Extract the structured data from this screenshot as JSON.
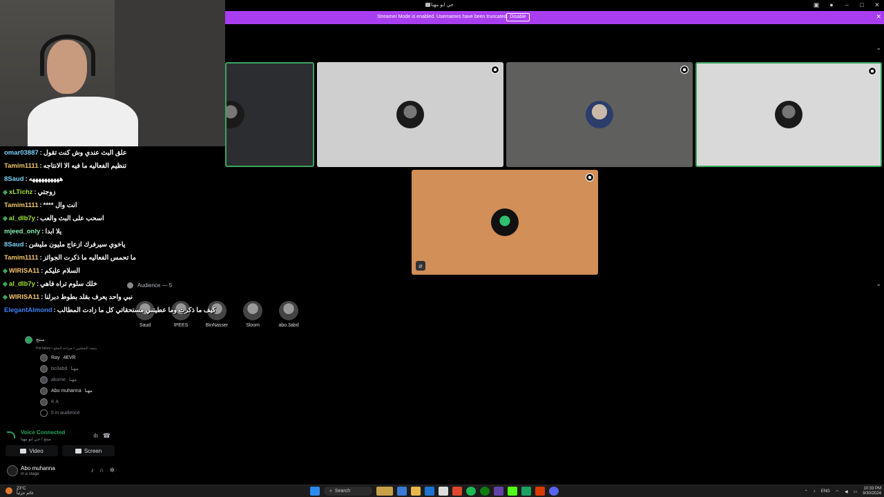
{
  "window": {
    "title": "حي ابو مهنا"
  },
  "banner": {
    "message": "Streamer Mode is enabled. Usernames have been truncated.",
    "disable_label": "Disable"
  },
  "audience": {
    "header": "Audience — 5",
    "members": [
      "Saud",
      "IPEES",
      "BinNasser",
      "Sloom",
      "abo.3abd"
    ]
  },
  "chat": [
    {
      "user": "omar03887",
      "color": "#7dd3fc",
      "badge": false,
      "text": "علق البث عندي وش كنت تقول"
    },
    {
      "user": "Tamim1111",
      "color": "#f5c76b",
      "badge": false,
      "text": "تنظيم الفعاليه ما فيه الا الانتاجه"
    },
    {
      "user": "8Saud",
      "color": "#7dd3fc",
      "badge": false,
      "text": "ههههههههههه"
    },
    {
      "user": "xLTichz",
      "color": "#a3e635",
      "badge": true,
      "text": "زوجتي"
    },
    {
      "user": "Tamim1111",
      "color": "#f5c76b",
      "badge": false,
      "text": "انت وال ****"
    },
    {
      "user": "al_dlb7y",
      "color": "#a3e635",
      "badge": true,
      "text": "اسحب على البث والعب"
    },
    {
      "user": "mjeed_only",
      "color": "#86efac",
      "badge": false,
      "text": "يلا ابدا"
    },
    {
      "user": "8Saud",
      "color": "#7dd3fc",
      "badge": false,
      "text": "ياخوي سيرفرك ازعاج مليون مليشن"
    },
    {
      "user": "Tamim1111",
      "color": "#f5c76b",
      "badge": false,
      "text": "ما تحمس الفعاليه ما ذكرت الجوائز"
    },
    {
      "user": "WIRISA11",
      "color": "#f5c76b",
      "badge": true,
      "text": "السلام عليكم"
    },
    {
      "user": "al_dlb7y",
      "color": "#a3e635",
      "badge": true,
      "text": "خلك سلوم تراه فاهي"
    },
    {
      "user": "WIRISA11",
      "color": "#f5c76b",
      "badge": true,
      "text": "نبي واحد يعرف بقلد بطوط دبرلنا"
    },
    {
      "user": "ElegantAlmond",
      "color": "#3b82f6",
      "badge": false,
      "text": "كيف ما ذكرت وما عطيتني مستحقاتي كل ما زادت المطالب"
    }
  ],
  "sidebar": {
    "stage_row": {
      "label": "منتج",
      "sub": "Hot takes • منصة الشعليين • صراحه الشلع"
    },
    "members": [
      {
        "name": "Ray",
        "tag": "4EVR",
        "dim": false
      },
      {
        "name": "bo3abd",
        "tag": "مهنا",
        "dim": true
      },
      {
        "name": "akome",
        "tag": "مهنا",
        "dim": true
      },
      {
        "name": "Abo muhanna",
        "tag": "مهنا",
        "dim": false
      },
      {
        "name": "K A",
        "tag": "",
        "dim": true
      }
    ],
    "in_audience": "5 in audience"
  },
  "voice": {
    "status": "Voice Connected",
    "sub": "منتج / حي ابو مهنا",
    "video_label": "Video",
    "screen_label": "Screen"
  },
  "user": {
    "name": "Abo muhanna",
    "status": "In a stage"
  },
  "taskbar": {
    "weather_temp": "23°C",
    "weather_desc": "غائم جزئياً",
    "search_label": "Search",
    "lang": "ENG",
    "time": "10:33 PM",
    "date": "9/30/2024"
  }
}
